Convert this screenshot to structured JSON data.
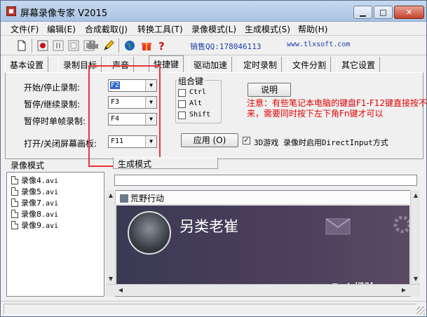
{
  "window": {
    "title": "屏幕录像专家 V2015",
    "minimize_glyph": "▁",
    "maximize_glyph": "□",
    "close_glyph": "✕"
  },
  "menu": {
    "items": [
      "文件(F)",
      "编辑(E)",
      "合成截取(J)",
      "转换工具(T)",
      "录像模式(L)",
      "生成模式(S)",
      "帮助(H)"
    ]
  },
  "toolbar": {
    "icons": [
      "new-file-icon",
      "record-icon",
      "pause-icon",
      "stop-icon",
      "camera-icon",
      "pencil-icon",
      "globe-icon",
      "gift-icon",
      "help-icon"
    ],
    "qq": "销售QQ:178046113",
    "site": "www.tlxsoft.com"
  },
  "tabs": [
    "基本设置",
    "录制目标",
    "声音",
    "快捷键",
    "驱动加速",
    "定时录制",
    "文件分割",
    "其它设置"
  ],
  "active_tab": "快捷键",
  "hotkeys": {
    "start_stop_label": "开始/停止录制:",
    "start_stop_value": "F2",
    "pause_label": "暂停/继续录制:",
    "pause_value": "F3",
    "frame_label": "暂停时单帧录制:",
    "frame_value": "F4",
    "screen_label": "打开/关闭屏幕画板:",
    "screen_value": "F11"
  },
  "combo_key": {
    "title": "组合键",
    "ctrl": "Ctrl",
    "alt": "Alt",
    "shift": "Shift"
  },
  "explain_button": "说明",
  "note": "注意：有些笔记本电脑的键盘F1-F12键直接按不出来，需要同时按下左下角Fn键才可以",
  "apply_button": "应用 (O)",
  "directinput": {
    "checked": true,
    "label": "3D游戏 录像时启用DirectInput方式"
  },
  "record_mode_label": "录像模式",
  "gen_mode_label": "生成模式",
  "files": [
    {
      "name": "录像4",
      "ext": ".avi"
    },
    {
      "name": "录像5",
      "ext": ".avi"
    },
    {
      "name": "录像7",
      "ext": ".avi"
    },
    {
      "name": "录像8",
      "ext": ".avi"
    },
    {
      "name": "录像9",
      "ext": ".avi"
    }
  ],
  "preview": {
    "window_title": "荒野行动",
    "player_name": "另类老崔"
  },
  "watermark": "Bai 经验"
}
